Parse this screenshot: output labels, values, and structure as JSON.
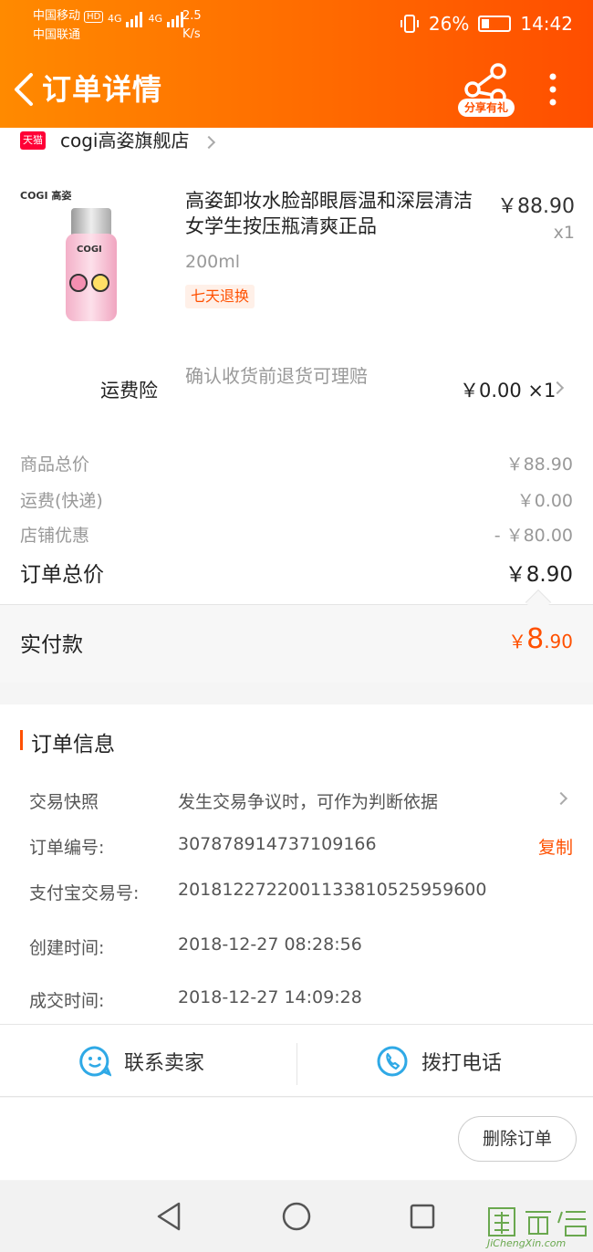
{
  "status_bar": {
    "carrier1": "中国移动",
    "carrier1_badge": "HD",
    "carrier2": "中国联通",
    "net1": "4G",
    "net2": "4G",
    "speed_value": "2.5",
    "speed_unit": "K/s",
    "battery": "26%",
    "time": "14:42"
  },
  "header": {
    "title": "订单详情",
    "share_label": "分享有礼"
  },
  "store": {
    "badge": "天猫",
    "name": "cogi高姿旗舰店"
  },
  "product": {
    "brand": "COGI 高姿",
    "bottle_label": "COGI",
    "name": "高姿卸妆水脸部眼唇温和深层清洁女学生按压瓶清爽正品",
    "price": "￥88.90",
    "qty": "x1",
    "spec": "200ml",
    "tag": "七天退换"
  },
  "insurance": {
    "label": "运费险",
    "desc": "确认收货前退货可理赔",
    "price": "￥0.00 ×1"
  },
  "summary": {
    "goods_total_label": "商品总价",
    "goods_total": "￥88.90",
    "shipping_label": "运费(快递)",
    "shipping": "￥0.00",
    "discount_label": "店铺优惠",
    "discount": "- ￥80.00",
    "order_total_label": "订单总价",
    "order_total": "￥8.90"
  },
  "paid": {
    "label": "实付款",
    "currency": "￥",
    "integer": "8",
    "decimal": ".90"
  },
  "order_info": {
    "title": "订单信息",
    "snapshot_label": "交易快照",
    "snapshot_value": "发生交易争议时，可作为判断依据",
    "order_no_label": "订单编号:",
    "order_no": "307878914737109166",
    "copy_label": "复制",
    "alipay_label": "支付宝交易号:",
    "alipay_no": "2018122722001133810525959600",
    "created_label": "创建时间:",
    "created": "2018-12-27 08:28:56",
    "closed_label": "成交时间:",
    "closed": "2018-12-27 14:09:28"
  },
  "actions": {
    "contact_seller": "联系卖家",
    "call_phone": "拨打电话",
    "delete_order": "删除订单"
  },
  "watermark": {
    "text": "JiChengXin.com"
  },
  "colors": {
    "header_start": "#ff8a00",
    "header_end": "#ff4e00",
    "accent": "#ff5000",
    "tmall_red": "#ff0036",
    "icon_blue": "#2fa9e6"
  }
}
